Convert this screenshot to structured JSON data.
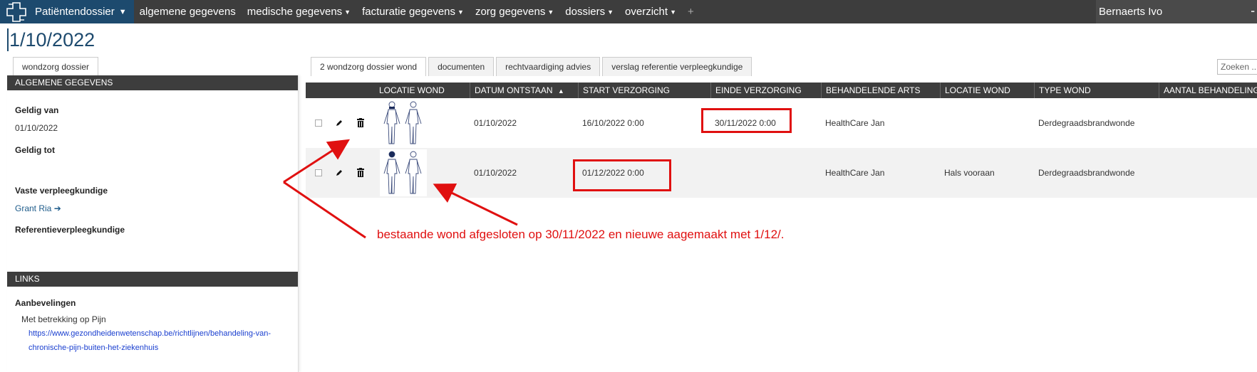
{
  "nav": {
    "brand": "Patiëntendossier",
    "items": [
      {
        "label": "algemene gegevens",
        "dropdown": false
      },
      {
        "label": "medische gegevens",
        "dropdown": true
      },
      {
        "label": "facturatie gegevens",
        "dropdown": true
      },
      {
        "label": "zorg gegevens",
        "dropdown": true
      },
      {
        "label": "dossiers",
        "dropdown": true
      },
      {
        "label": "overzicht",
        "dropdown": true
      }
    ],
    "plus": "+",
    "user": "Bernaerts  Ivo",
    "menu_dots": "..",
    "colors": {
      "bar": "#3d3d3d",
      "brand": "#1d4a6e"
    }
  },
  "page": {
    "title": "1/10/2022"
  },
  "left": {
    "tab": "wondzorg dossier",
    "general": {
      "header": "ALGEMENE GEGEVENS",
      "geldig_van_label": "Geldig van",
      "geldig_van_value": "01/10/2022",
      "geldig_tot_label": "Geldig tot",
      "vaste_label": "Vaste verpleegkundige",
      "vaste_value": "Grant Ria",
      "referentie_label": "Referentieverpleegkundige"
    },
    "links": {
      "header": "LINKS",
      "aanbevelingen_label": "Aanbevelingen",
      "betrekking": "Met betrekking op Pijn",
      "url": "https://www.gezondheidenwetenschap.be/richtlijnen/behandeling-van-chronische-pijn-buiten-het-ziekenhuis"
    }
  },
  "right": {
    "tabs": [
      "2 wondzorg dossier wond",
      "documenten",
      "rechtvaardiging advies",
      "verslag referentie verpleegkundige"
    ],
    "search_placeholder": "Zoeken ...",
    "columns": [
      "LOCATIE WOND",
      "DATUM ONTSTAAN",
      "START VERZORGING",
      "EINDE VERZORGING",
      "BEHANDELENDE ARTS",
      "LOCATIE WOND",
      "TYPE WOND",
      "AANTAL BEHANDELING"
    ],
    "sort_indicator": "▲",
    "rows": [
      {
        "datum_ontstaan": "01/10/2022",
        "start": "16/10/2022 0:00",
        "einde": "30/11/2022 0:00",
        "arts": "HealthCare Jan",
        "locatie": "",
        "type": "Derdegraadsbrandwonde"
      },
      {
        "datum_ontstaan": "01/10/2022",
        "start": "01/12/2022 0:00",
        "einde": "",
        "arts": "HealthCare Jan",
        "locatie": "Hals vooraan",
        "type": "Derdegraadsbrandwonde"
      }
    ]
  },
  "annotation": {
    "text": "bestaande wond afgesloten op 30/11/2022 en nieuwe aagemaakt met 1/12/.",
    "color": "#e01010"
  }
}
